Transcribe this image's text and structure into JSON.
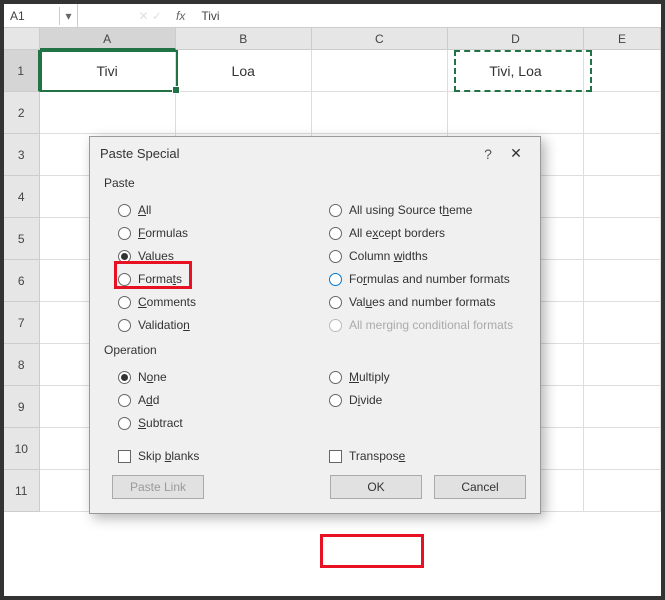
{
  "namebox": "A1",
  "formula": "Tivi",
  "fx": "fx",
  "columns": [
    "A",
    "B",
    "C",
    "D",
    "E"
  ],
  "rows": [
    "1",
    "2",
    "3",
    "4",
    "5",
    "6",
    "7",
    "8",
    "9",
    "10",
    "11"
  ],
  "cells": {
    "A1": "Tivi",
    "B1": "Loa",
    "D1": "Tivi, Loa"
  },
  "dialog": {
    "title": "Paste Special",
    "help": "?",
    "close": "✕",
    "paste_label": "Paste",
    "paste_left": [
      {
        "key": "all",
        "pre": "",
        "u": "A",
        "post": "ll"
      },
      {
        "key": "formulas",
        "pre": "",
        "u": "F",
        "post": "ormulas"
      },
      {
        "key": "values",
        "pre": "",
        "u": "V",
        "post": "alues"
      },
      {
        "key": "formats",
        "pre": "Forma",
        "u": "t",
        "post": "s"
      },
      {
        "key": "comments",
        "pre": "",
        "u": "C",
        "post": "omments"
      },
      {
        "key": "validation",
        "pre": "Validatio",
        "u": "n",
        "post": ""
      }
    ],
    "paste_right": [
      {
        "key": "theme",
        "pre": "All using Source t",
        "u": "h",
        "post": "eme"
      },
      {
        "key": "borders",
        "pre": "All e",
        "u": "x",
        "post": "cept borders"
      },
      {
        "key": "widths",
        "pre": "Column ",
        "u": "w",
        "post": "idths"
      },
      {
        "key": "formnum",
        "pre": "Fo",
        "u": "r",
        "post": "mulas and number formats"
      },
      {
        "key": "valnum",
        "pre": "Val",
        "u": "u",
        "post": "es and number formats"
      },
      {
        "key": "merge",
        "pre": "All mer",
        "u": "g",
        "post": "ing conditional formats"
      }
    ],
    "op_label": "Operation",
    "op_left": [
      {
        "key": "none",
        "pre": "N",
        "u": "o",
        "post": "ne"
      },
      {
        "key": "add",
        "pre": "A",
        "u": "d",
        "post": "d"
      },
      {
        "key": "subtract",
        "pre": "",
        "u": "S",
        "post": "ubtract"
      }
    ],
    "op_right": [
      {
        "key": "multiply",
        "pre": "",
        "u": "M",
        "post": "ultiply"
      },
      {
        "key": "divide",
        "pre": "D",
        "u": "i",
        "post": "vide"
      }
    ],
    "skip": {
      "pre": "Skip ",
      "u": "b",
      "post": "lanks"
    },
    "transpose": {
      "pre": "Transpos",
      "u": "e",
      "post": ""
    },
    "paste_link": "Paste Link",
    "ok": "OK",
    "cancel": "Cancel",
    "paste_selected": "values",
    "op_selected": "none"
  }
}
